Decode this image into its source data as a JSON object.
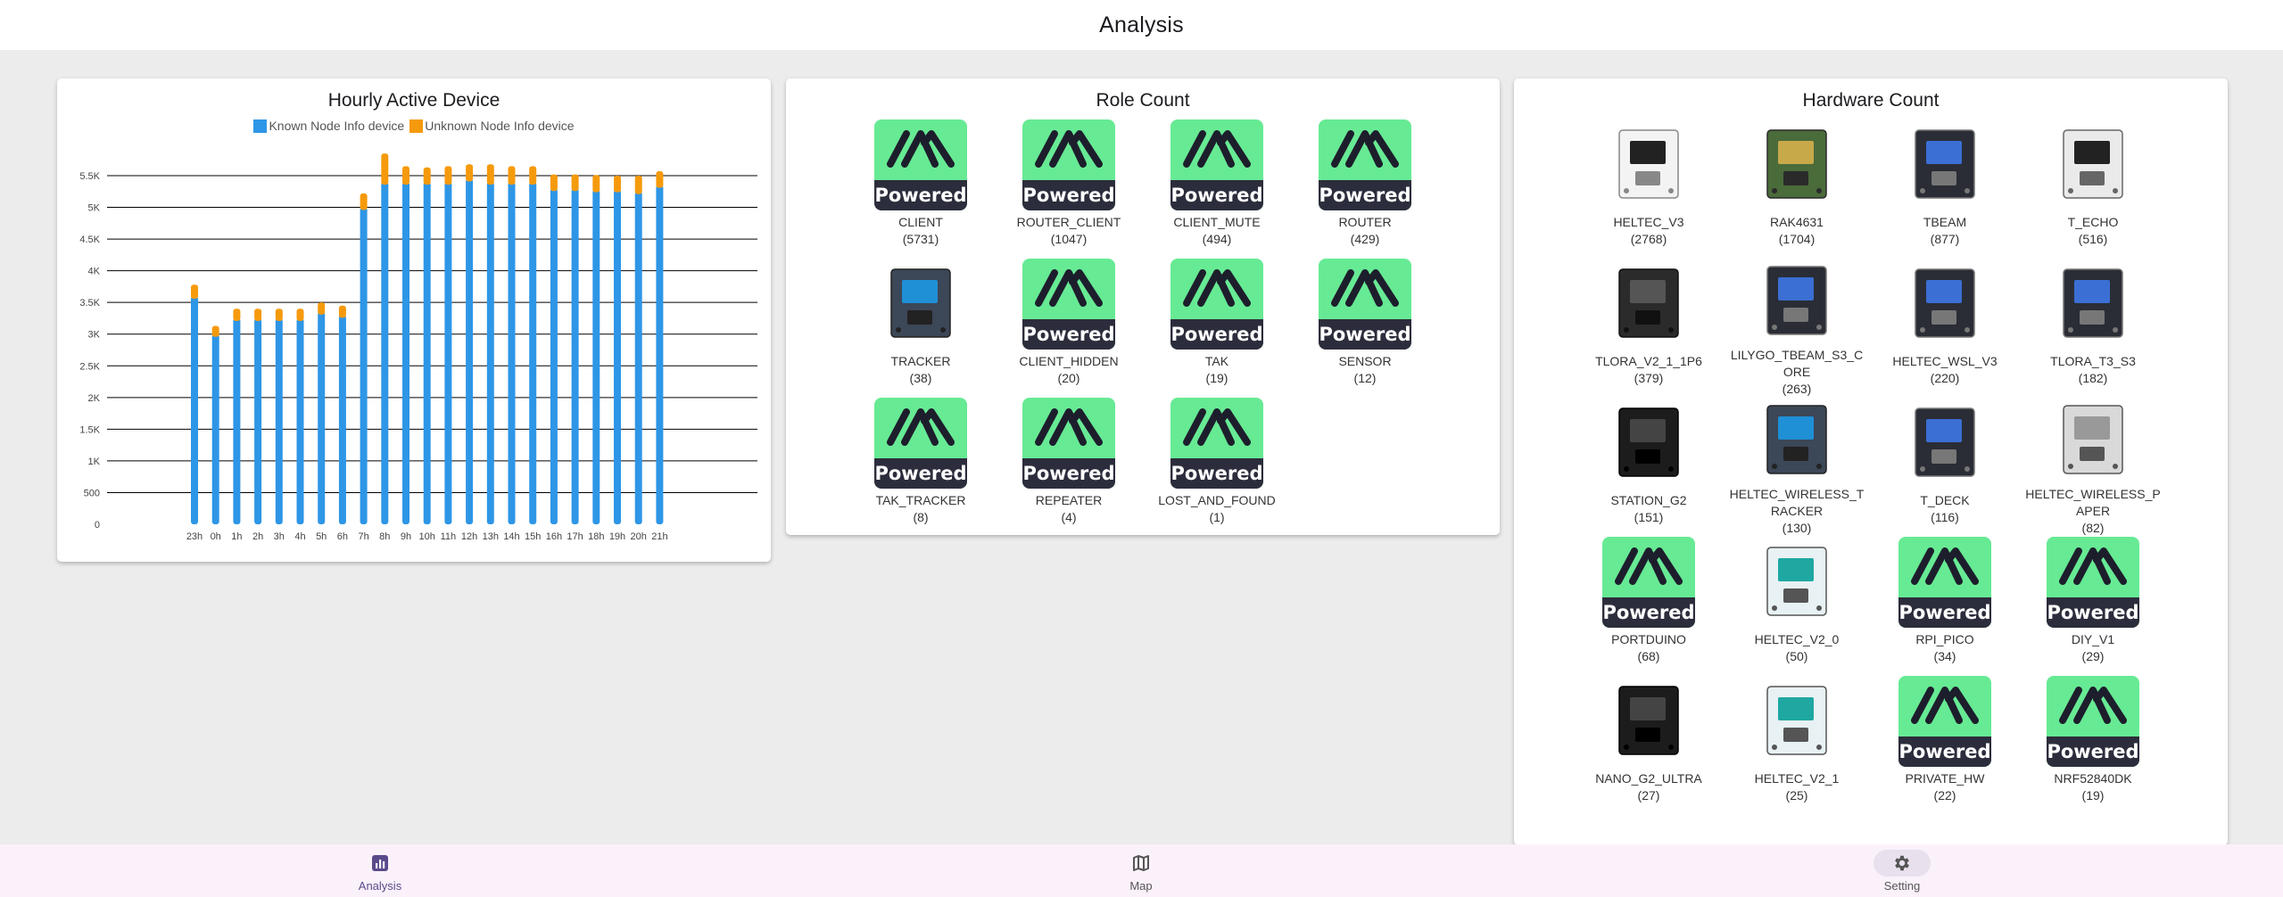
{
  "appbar": {
    "title": "Analysis"
  },
  "hourly": {
    "title": "Hourly Active Device",
    "legend": {
      "known": "Known Node Info device",
      "unknown": "Unknown Node Info device"
    }
  },
  "colors": {
    "known": "#2e96e6",
    "unknown": "#f59a0c",
    "powered_bg": "#67ea94",
    "powered_band": "#2c2d3c",
    "nav_active": "#5b4a8b"
  },
  "chart_data": {
    "type": "bar",
    "stacked": true,
    "title": "Hourly Active Device",
    "categories": [
      "23h",
      "0h",
      "1h",
      "2h",
      "3h",
      "4h",
      "5h",
      "6h",
      "7h",
      "8h",
      "9h",
      "10h",
      "11h",
      "12h",
      "13h",
      "14h",
      "15h",
      "16h",
      "17h",
      "18h",
      "19h",
      "20h",
      "21h"
    ],
    "series": [
      {
        "name": "Known Node Info device",
        "color": "#2e96e6",
        "values": [
          3600,
          3000,
          3250,
          3250,
          3250,
          3250,
          3350,
          3300,
          5000,
          5400,
          5400,
          5400,
          5400,
          5450,
          5400,
          5400,
          5400,
          5300,
          5300,
          5280,
          5280,
          5250,
          5350
        ]
      },
      {
        "name": "Unknown Node Info device",
        "color": "#f59a0c",
        "values": [
          180,
          130,
          150,
          150,
          150,
          150,
          150,
          150,
          220,
          450,
          250,
          230,
          250,
          230,
          280,
          250,
          250,
          220,
          220,
          230,
          220,
          250,
          220
        ]
      }
    ],
    "y_ticks": [
      "0",
      "500",
      "1K",
      "1.5K",
      "2K",
      "2.5K",
      "3K",
      "3.5K",
      "4K",
      "4.5K",
      "5K",
      "5.5K"
    ],
    "ylim": [
      0,
      5500
    ],
    "grid": true,
    "legend_position": "top-center"
  },
  "role": {
    "title": "Role Count",
    "items": [
      {
        "label": "CLIENT",
        "count": "(5731)",
        "icon": "powered"
      },
      {
        "label": "ROUTER_CLIENT",
        "count": "(1047)",
        "icon": "powered"
      },
      {
        "label": "CLIENT_MUTE",
        "count": "(494)",
        "icon": "powered"
      },
      {
        "label": "ROUTER",
        "count": "(429)",
        "icon": "powered"
      },
      {
        "label": "TRACKER",
        "count": "(38)",
        "icon": "board-blue"
      },
      {
        "label": "CLIENT_HIDDEN",
        "count": "(20)",
        "icon": "powered"
      },
      {
        "label": "TAK",
        "count": "(19)",
        "icon": "powered"
      },
      {
        "label": "SENSOR",
        "count": "(12)",
        "icon": "powered"
      },
      {
        "label": "TAK_TRACKER",
        "count": "(8)",
        "icon": "powered"
      },
      {
        "label": "REPEATER",
        "count": "(4)",
        "icon": "powered"
      },
      {
        "label": "LOST_AND_FOUND",
        "count": "(1)",
        "icon": "powered"
      }
    ]
  },
  "hardware": {
    "title": "Hardware Count",
    "items": [
      {
        "label": "HELTEC_V3",
        "count": "(2768)",
        "icon": "board-white"
      },
      {
        "label": "RAK4631",
        "count": "(1704)",
        "icon": "board-green"
      },
      {
        "label": "TBEAM",
        "count": "(877)",
        "icon": "board-dark"
      },
      {
        "label": "T_ECHO",
        "count": "(516)",
        "icon": "board-echo"
      },
      {
        "label": "TLORA_V2_1_1P6",
        "count": "(379)",
        "icon": "board-antenna"
      },
      {
        "label": "LILYGO_TBEAM_S3_CORE",
        "count": "(263)",
        "icon": "board-dark"
      },
      {
        "label": "HELTEC_WSL_V3",
        "count": "(220)",
        "icon": "board-dark"
      },
      {
        "label": "TLORA_T3_S3",
        "count": "(182)",
        "icon": "board-dark"
      },
      {
        "label": "STATION_G2",
        "count": "(151)",
        "icon": "board-black"
      },
      {
        "label": "HELTEC_WIRELESS_TRACKER",
        "count": "(130)",
        "icon": "board-blue"
      },
      {
        "label": "T_DECK",
        "count": "(116)",
        "icon": "board-dark"
      },
      {
        "label": "HELTEC_WIRELESS_PAPER",
        "count": "(82)",
        "icon": "board-paper"
      },
      {
        "label": "PORTDUINO",
        "count": "(68)",
        "icon": "powered"
      },
      {
        "label": "HELTEC_V2_0",
        "count": "(50)",
        "icon": "board-teal"
      },
      {
        "label": "RPI_PICO",
        "count": "(34)",
        "icon": "powered"
      },
      {
        "label": "DIY_V1",
        "count": "(29)",
        "icon": "powered"
      },
      {
        "label": "NANO_G2_ULTRA",
        "count": "(27)",
        "icon": "board-black"
      },
      {
        "label": "HELTEC_V2_1",
        "count": "(25)",
        "icon": "board-teal"
      },
      {
        "label": "PRIVATE_HW",
        "count": "(22)",
        "icon": "powered"
      },
      {
        "label": "NRF52840DK",
        "count": "(19)",
        "icon": "powered"
      }
    ]
  },
  "powered_text": "Powered",
  "nav": {
    "items": [
      {
        "label": "Analysis",
        "icon": "bar-chart-icon",
        "active": true
      },
      {
        "label": "Map",
        "icon": "map-icon",
        "active": false
      },
      {
        "label": "Setting",
        "icon": "gear-icon",
        "active": false
      }
    ]
  }
}
